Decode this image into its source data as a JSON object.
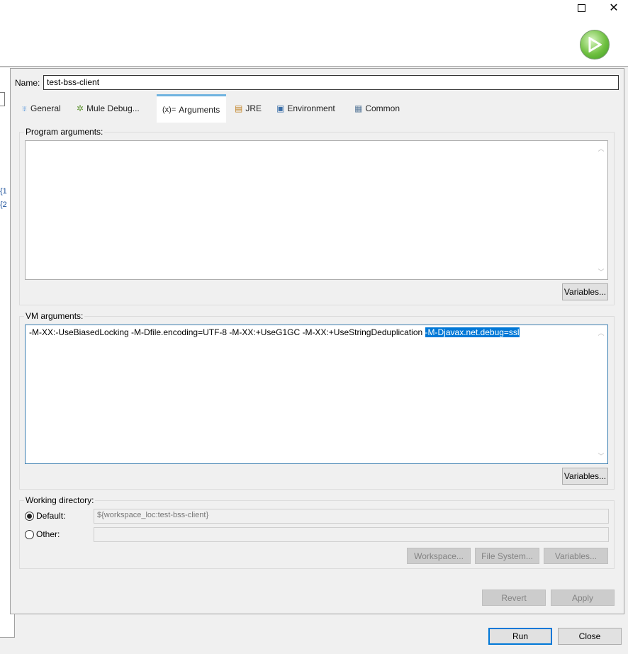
{
  "window": {
    "maximize_icon": "square-icon",
    "close_icon": "x-icon",
    "run_icon": "green-play-icon"
  },
  "left_panel": {
    "fragments": [
      "{1",
      "{2"
    ]
  },
  "name": {
    "label": "Name:",
    "value": "test-bss-client"
  },
  "tabs": [
    {
      "label": "General",
      "icon": "mule-icon"
    },
    {
      "label": "Mule Debug...",
      "icon": "bug-icon"
    },
    {
      "label": "Arguments",
      "icon_text": "(x)=",
      "active": true
    },
    {
      "label": "JRE",
      "icon": "library-icon"
    },
    {
      "label": "Environment",
      "icon": "environment-icon"
    },
    {
      "label": "Common",
      "icon": "common-icon"
    }
  ],
  "program_args": {
    "label": "Program arguments:",
    "value": "",
    "variables": "Variables..."
  },
  "vm_args": {
    "label": "VM arguments:",
    "value_plain": "-M-XX:-UseBiasedLocking -M-Dfile.encoding=UTF-8 -M-XX:+UseG1GC -M-XX:+UseStringDeduplication ",
    "value_selected": "-M-Djavax.net.debug=ssl",
    "variables": "Variables..."
  },
  "working_dir": {
    "label": "Working directory:",
    "default_label": "Default:",
    "default_value": "${workspace_loc:test-bss-client}",
    "default_selected": true,
    "other_label": "Other:",
    "other_value": "",
    "workspace": "Workspace...",
    "file_system": "File System...",
    "variables": "Variables..."
  },
  "actions": {
    "revert": "Revert",
    "apply": "Apply",
    "run": "Run",
    "close": "Close"
  },
  "colors": {
    "accent": "#0078d7",
    "tab_indicator": "#6fb3e0"
  }
}
